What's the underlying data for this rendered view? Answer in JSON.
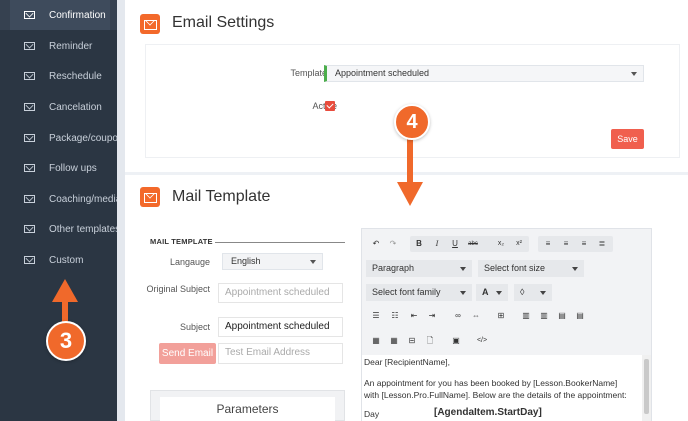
{
  "sidebar": {
    "items": [
      {
        "label": "Confirmation",
        "icon": "envelope-icon",
        "active": true
      },
      {
        "label": "Reminder",
        "icon": "envelope-icon"
      },
      {
        "label": "Reschedule",
        "icon": "envelope-icon"
      },
      {
        "label": "Cancelation",
        "icon": "envelope-icon"
      },
      {
        "label": "Package/coupons",
        "icon": "envelope-icon"
      },
      {
        "label": "Follow ups",
        "icon": "envelope-icon"
      },
      {
        "label": "Coaching/media",
        "icon": "envelope-icon"
      },
      {
        "label": "Other templates",
        "icon": "envelope-icon"
      },
      {
        "label": "Custom",
        "icon": "envelope-icon"
      }
    ]
  },
  "email_settings": {
    "title": "Email Settings",
    "template_name_label": "Template name",
    "template_name_value": "Appointment scheduled",
    "active_label": "Active",
    "active_checked": true,
    "save_label": "Save"
  },
  "mail_template": {
    "title": "Mail Template",
    "section_label": "MAIL TEMPLATE",
    "language_label": "Langauge",
    "language_value": "English",
    "original_subject_label": "Original Subject",
    "original_subject_value": "Appointment scheduled",
    "subject_label": "Subject",
    "subject_value": "Appointment scheduled",
    "send_email_label": "Send Email",
    "test_email_placeholder": "Test Email Address",
    "parameters_title": "Parameters"
  },
  "editor": {
    "paragraph_select": "Paragraph",
    "font_size_select": "Select font size",
    "font_family_select": "Select font family",
    "font_color_label": "A",
    "content": {
      "line1": "Dear [RecipientName],",
      "line2": "An appointment for you has been booked by [Lesson.BookerName]",
      "line3": "with [Lesson.Pro.FullName]. Below are the details of the appointment:",
      "day_label": "Day",
      "day_value": "[AgendaItem.StartDay]"
    }
  },
  "annotations": {
    "callout_3": "3",
    "callout_4": "4",
    "accent_color": "#f0692b"
  }
}
